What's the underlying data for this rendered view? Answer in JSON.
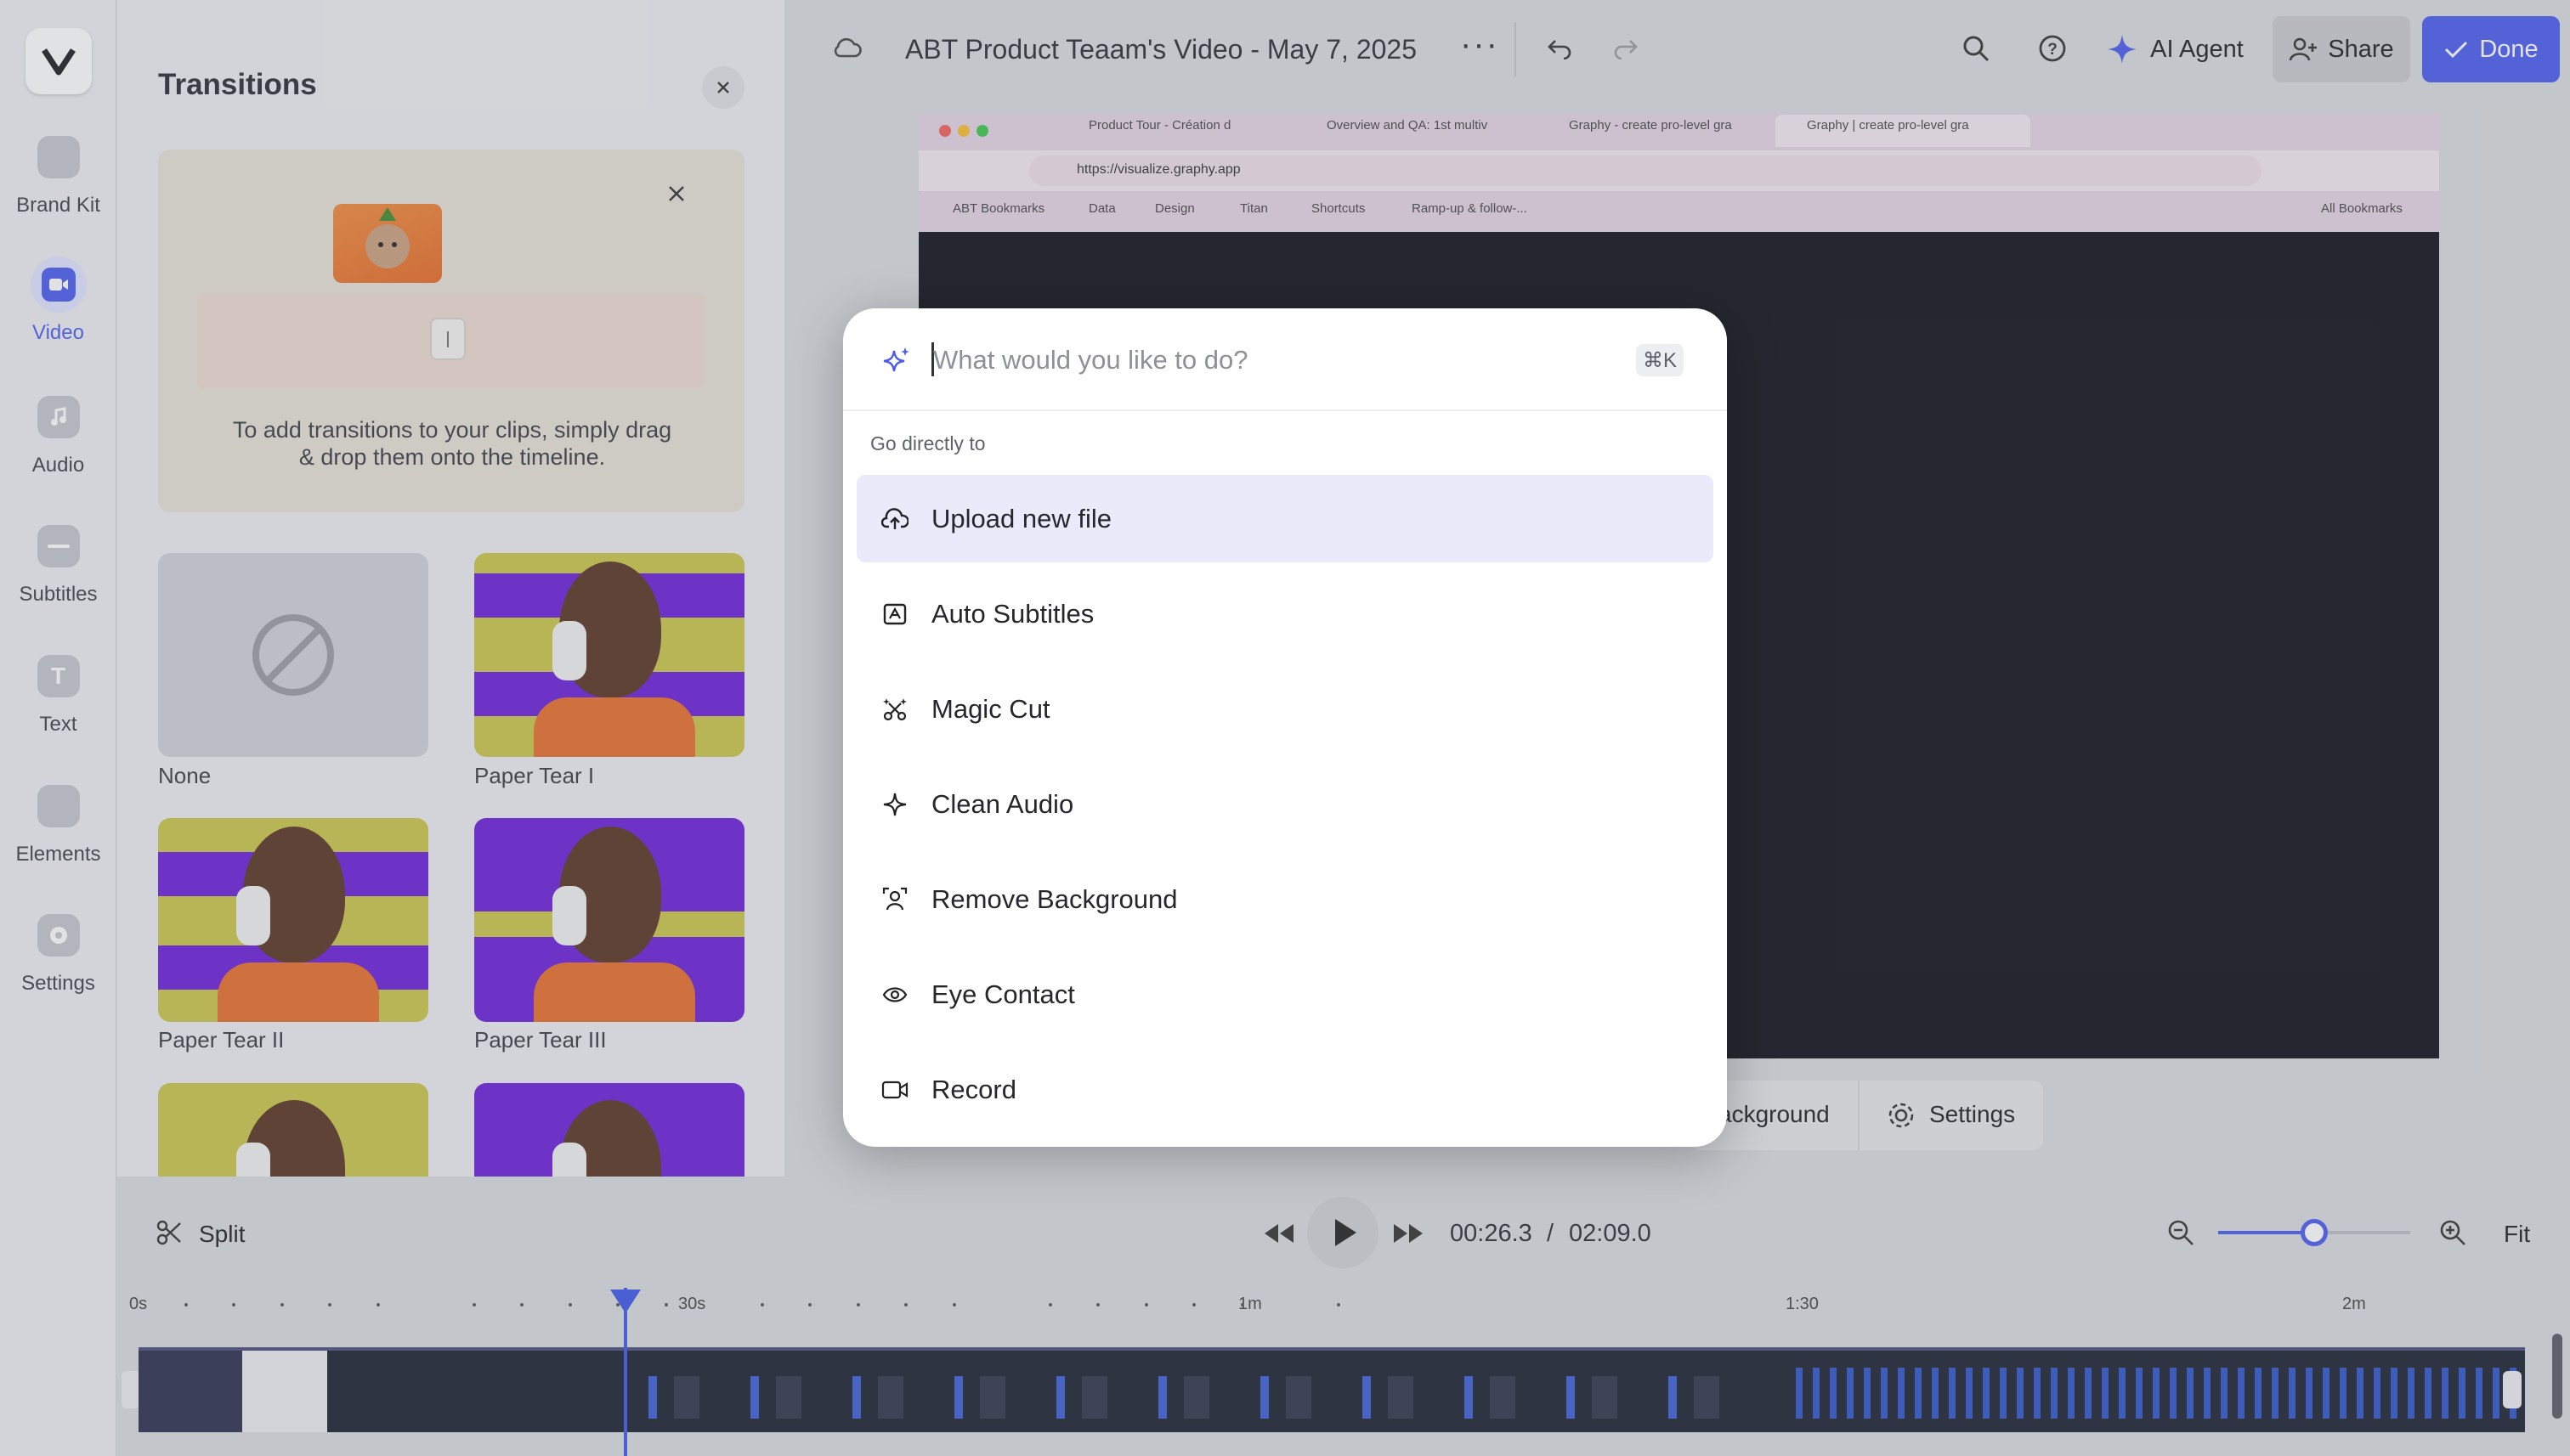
{
  "rail": {
    "items": [
      {
        "label": "Brand Kit",
        "icon": "brand-kit-icon"
      },
      {
        "label": "Video",
        "icon": "video-icon",
        "active": true
      },
      {
        "label": "Audio",
        "icon": "music-note-icon"
      },
      {
        "label": "Subtitles",
        "icon": "subtitles-icon"
      },
      {
        "label": "Text",
        "icon": "text-icon"
      },
      {
        "label": "Elements",
        "icon": "elements-icon"
      },
      {
        "label": "Settings",
        "icon": "settings-icon"
      }
    ]
  },
  "panel": {
    "title": "Transitions",
    "tip_text": "To add transitions to your clips, simply drag & drop them onto the timeline.",
    "transitions": [
      {
        "label": "None"
      },
      {
        "label": "Paper Tear I"
      },
      {
        "label": "Paper Tear II"
      },
      {
        "label": "Paper Tear III"
      }
    ]
  },
  "topbar": {
    "project_title": "ABT Product Teaam's Video - May 7, 2025",
    "ai_agent": "AI Agent",
    "share": "Share",
    "done": "Done"
  },
  "browser": {
    "tabs": [
      "Product Tour - Création d",
      "Overview and QA: 1st multiv",
      "Graphy - create pro-level gra",
      "Graphy | create pro-level gra"
    ],
    "url": "https://visualize.graphy.app",
    "bookmarks": [
      "ABT Bookmarks",
      "Data",
      "Design",
      "Titan",
      "Shortcuts",
      "Ramp-up & follow-..."
    ],
    "all_bookmarks": "All Bookmarks"
  },
  "preview_toolbar": {
    "background": "ackground",
    "settings": "Settings"
  },
  "timeline": {
    "split": "Split",
    "current_time": "00:26.3",
    "separator": "/",
    "total_time": "02:09.0",
    "fit": "Fit",
    "zoom_level": 0.5,
    "ruler": [
      "0s",
      "30s",
      "1m",
      "1:30",
      "2m"
    ]
  },
  "palette": {
    "placeholder": "What would you like to do?",
    "shortcut": "⌘K",
    "section": "Go directly to",
    "commands": [
      {
        "label": "Upload new file",
        "icon": "cloud-upload-icon",
        "selected": true
      },
      {
        "label": "Auto Subtitles",
        "icon": "subtitles-icon"
      },
      {
        "label": "Magic Cut",
        "icon": "magic-cut-icon"
      },
      {
        "label": "Clean Audio",
        "icon": "sparkle-icon"
      },
      {
        "label": "Remove Background",
        "icon": "remove-background-icon"
      },
      {
        "label": "Eye Contact",
        "icon": "eye-icon"
      },
      {
        "label": "Record",
        "icon": "video-camera-icon"
      }
    ]
  },
  "colors": {
    "accent": "#4b5bf0",
    "done_button": "#4b5bf0",
    "selected_row": "#e9ebfb",
    "purple_tear": "#6a1fd9",
    "yellow_tear": "#c9c64a"
  }
}
